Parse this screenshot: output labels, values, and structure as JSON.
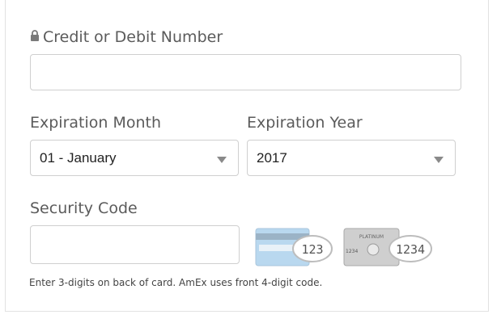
{
  "card_number": {
    "label": "Credit or Debit Number",
    "value": ""
  },
  "expiration_month": {
    "label": "Expiration Month",
    "selected": "01 - January"
  },
  "expiration_year": {
    "label": "Expiration Year",
    "selected": "2017"
  },
  "security_code": {
    "label": "Security Code",
    "value": "",
    "help": "Enter 3-digits on back of card. AmEx uses front 4-digit code."
  },
  "card_examples": {
    "back_card_code": "123",
    "amex_code": "1234",
    "amex_card_text": "PLATINUM",
    "amex_card_number": "1234"
  },
  "icons": {
    "lock": "lock-icon",
    "caret": "chevron-down-icon"
  },
  "colors": {
    "border": "#cfcfcf",
    "label": "#5b5b5b",
    "card_back": "#b9d8ef",
    "amex": "#cfcfcf"
  }
}
